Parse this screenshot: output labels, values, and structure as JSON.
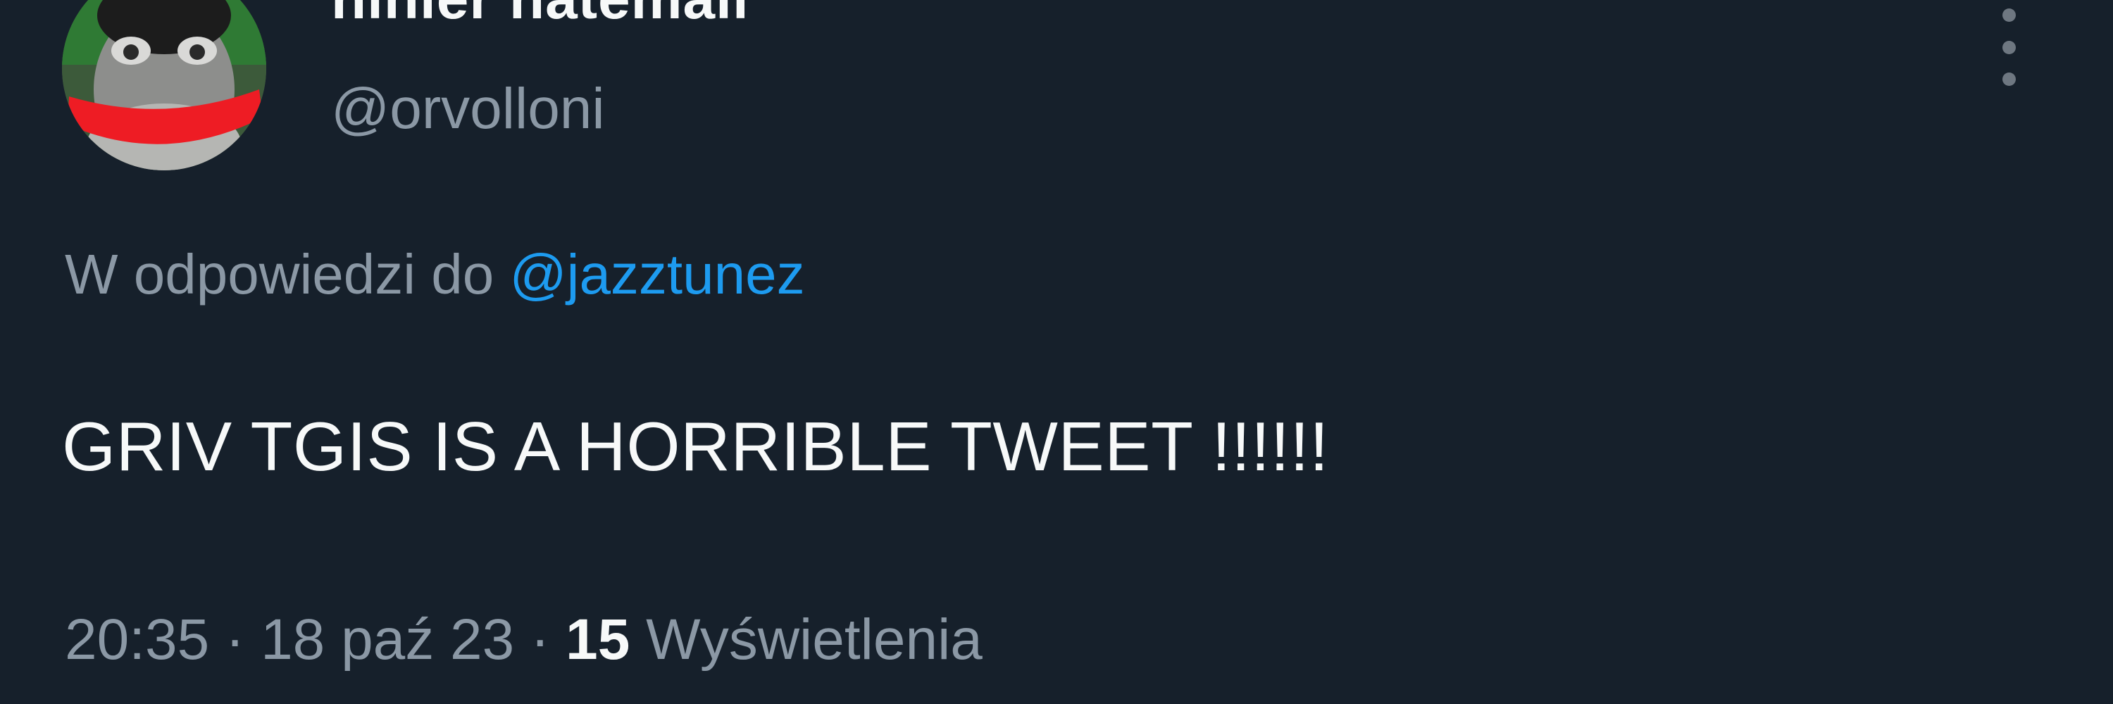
{
  "author": {
    "display_name": "nihier natemail",
    "handle": "@orvolloni",
    "avatar_icon": "profile-avatar-image"
  },
  "menu": {
    "more_icon": "more-vertical-icon"
  },
  "reply": {
    "prefix": "W odpowiedzi do ",
    "mention": "@jazztunez"
  },
  "tweet": {
    "text": "GRIV TGIS IS A HORRIBLE TWEET !!!!!!"
  },
  "meta": {
    "time": "20:35",
    "separator": " · ",
    "date": "18 paź 23",
    "views_count": "15",
    "views_label": " Wyświetlenia"
  },
  "colors": {
    "background": "#16202b",
    "primary_text": "#f7f9f9",
    "secondary_text": "#8b98a5",
    "link": "#1d9bf0"
  }
}
